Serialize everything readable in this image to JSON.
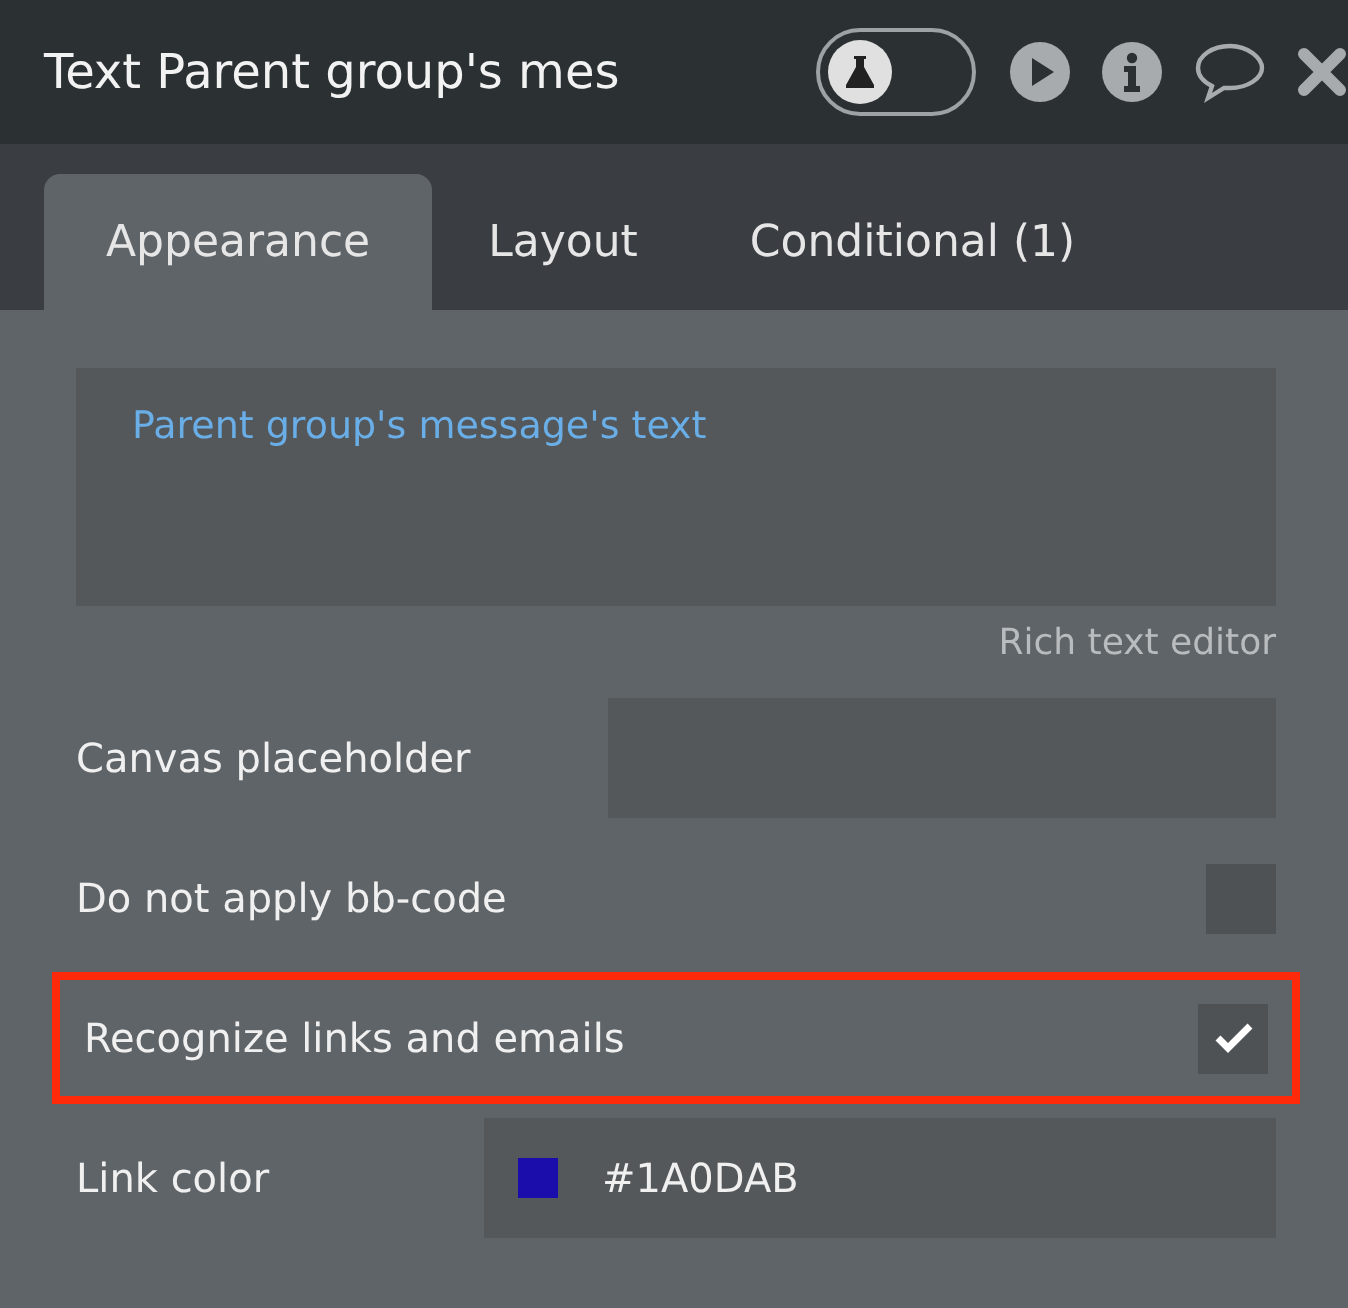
{
  "header": {
    "title": "Text Parent group's mes",
    "test_toggle": {
      "on": false
    }
  },
  "tabs": [
    {
      "label": "Appearance",
      "selected": true
    },
    {
      "label": "Layout",
      "selected": false
    },
    {
      "label": "Conditional (1)",
      "selected": false
    }
  ],
  "content_editor": {
    "value": "Parent group's message's text",
    "link": "Rich text editor"
  },
  "rows": [
    {
      "kind": "text_field",
      "label": "Canvas placeholder",
      "value": null,
      "highlighted": false
    },
    {
      "kind": "checkbox",
      "label": "Do not apply bb-code",
      "checked": false,
      "highlighted": false
    },
    {
      "kind": "checkbox",
      "label": "Recognize links and emails",
      "checked": true,
      "highlighted": true
    },
    {
      "kind": "color",
      "label": "Link color",
      "value": "#1A0DAB",
      "color": "#1a0dab",
      "highlighted": false
    }
  ]
}
